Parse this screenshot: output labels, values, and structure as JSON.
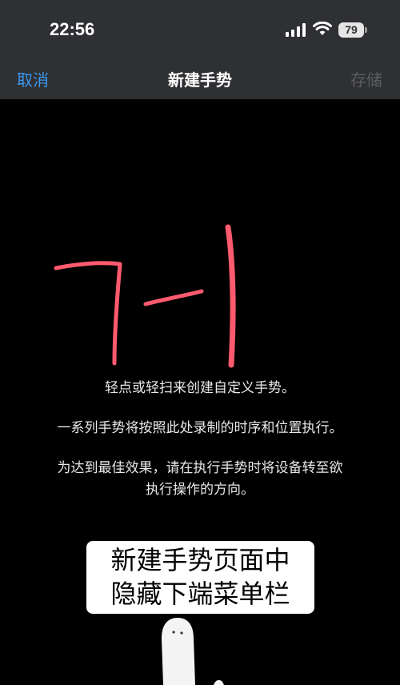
{
  "status_bar": {
    "time": "22:56",
    "battery_level": "79",
    "icons": [
      "signal-icon",
      "wifi-icon",
      "battery-icon"
    ]
  },
  "nav": {
    "cancel": "取消",
    "title": "新建手势",
    "save": "存储"
  },
  "colors": {
    "bar_background": "#2f3033",
    "accent_blue": "#3a98f0",
    "disabled_gray": "#5b5d62",
    "gesture_stroke": "#ff5a6e"
  },
  "instructions": [
    "轻点或轻扫来创建自定义手势。",
    "一系列手势将按照此处录制的时序和位置执行。",
    "为达到最佳效果，请在执行手势时将设备转至欲",
    "执行操作的方向。"
  ],
  "caption": {
    "line1": "新建手势页面中",
    "line2": "隐藏下端菜单栏"
  }
}
